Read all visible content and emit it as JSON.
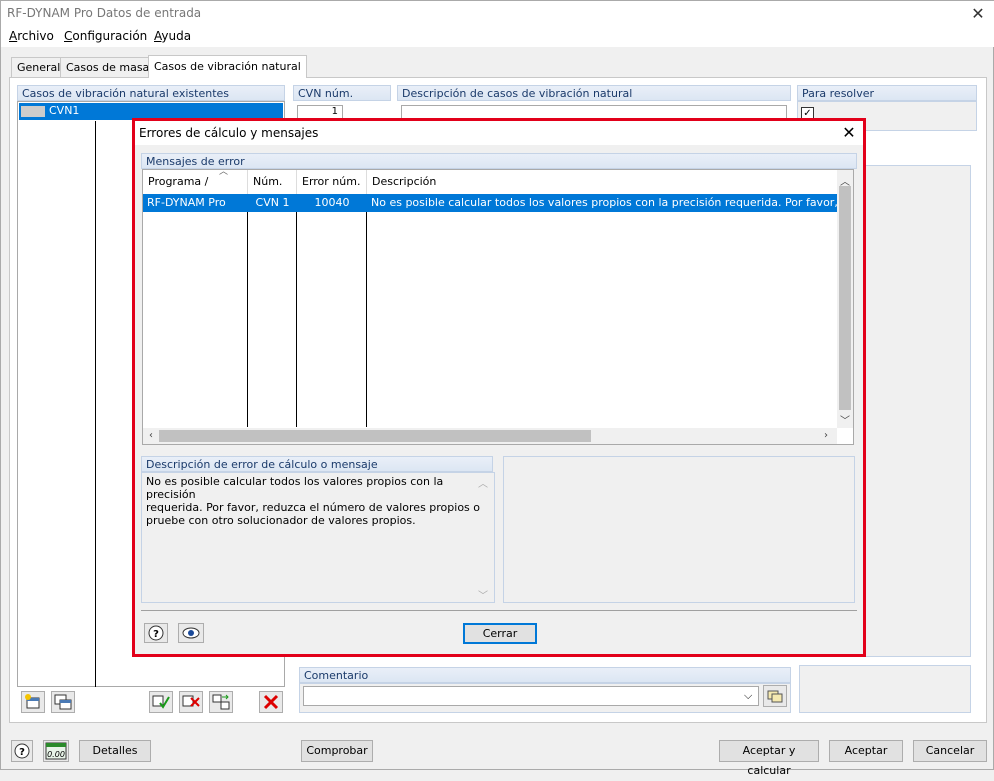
{
  "window": {
    "title": "RF-DYNAM Pro Datos de entrada",
    "close_glyph": "✕"
  },
  "menu": [
    {
      "underline": "A",
      "rest": "rchivo"
    },
    {
      "underline": "C",
      "rest": "onfiguración"
    },
    {
      "underline": "A",
      "rest": "yuda"
    }
  ],
  "tabs": [
    "General",
    "Casos de masas",
    "Casos de vibración natural"
  ],
  "cases_panel": {
    "header": "Casos de vibración natural existentes",
    "items": [
      {
        "label": "CVN1",
        "selected": true
      }
    ]
  },
  "cvn_num": {
    "header": "CVN núm.",
    "value": "1"
  },
  "description": {
    "header": "Descripción de casos de vibración natural"
  },
  "to_solve": {
    "header": "Para resolver",
    "checked": true
  },
  "comment": {
    "header": "Comentario",
    "value": ""
  },
  "footer": {
    "details": "Detalles",
    "check": "Comprobar",
    "accept_calc": "Aceptar y calcular",
    "accept": "Aceptar",
    "cancel": "Cancelar"
  },
  "dialog": {
    "title": "Errores de cálculo y mensajes",
    "errors_header": "Mensajes de error",
    "columns": [
      "Programa / Módulo",
      "Núm.",
      "Error núm.",
      "Descripción"
    ],
    "rows": [
      {
        "program": "RF-DYNAM Pro",
        "num": "CVN 1",
        "error_num": "10040",
        "description": "No es posible calcular todos los valores propios con la precisión requerida. Por favor, reduzca el n"
      }
    ],
    "detail_header": "Descripción de error de cálculo o mensaje",
    "detail_lines": [
      "No es posible calcular todos los valores propios con la precisión",
      "requerida. Por favor, reduzca el número de valores propios o",
      "pruebe con otro solucionador de valores propios."
    ],
    "close_button": "Cerrar"
  },
  "colors": {
    "accent": "#0078d7",
    "dialog_border": "#e2001a",
    "header_text": "#1a3a6a"
  }
}
